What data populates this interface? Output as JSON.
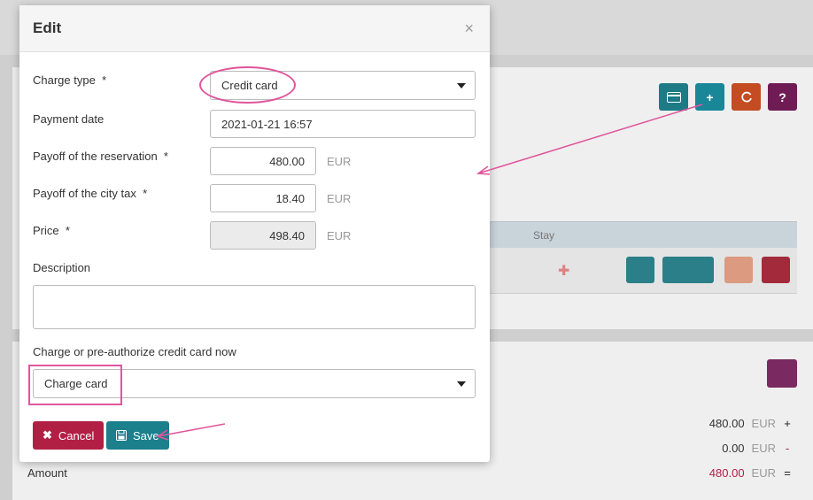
{
  "modal": {
    "title": "Edit",
    "close_symbol": "×",
    "charge_type": {
      "label": "Charge type",
      "required": "*",
      "value": "Credit card"
    },
    "payment_date": {
      "label": "Payment date",
      "value": "2021-01-21 16:57"
    },
    "payoff_reservation": {
      "label": "Payoff of the reservation",
      "required": "*",
      "value": "480.00",
      "unit": "EUR"
    },
    "payoff_city_tax": {
      "label": "Payoff of the city tax",
      "required": "*",
      "value": "18.40",
      "unit": "EUR"
    },
    "price": {
      "label": "Price",
      "required": "*",
      "value": "498.40",
      "unit": "EUR"
    },
    "description": {
      "label": "Description",
      "value": ""
    },
    "charge_now": {
      "label": "Charge or pre-authorize credit card now",
      "value": "Charge card"
    },
    "cancel_label": "Cancel",
    "save_label": "Save"
  },
  "background": {
    "table_header": "Stay",
    "help_symbol": "?",
    "add_symbol": "+",
    "totals": [
      {
        "value": "480.00",
        "unit": "EUR",
        "op": "+"
      },
      {
        "value": "0.00",
        "unit": "EUR",
        "op": "-"
      },
      {
        "value": "480.00",
        "unit": "EUR",
        "op": "="
      }
    ],
    "amount_label": "Amount"
  },
  "colors": {
    "cancel": "#b21f45",
    "save": "#1b7f8c",
    "annotation": "#e0559b",
    "total_negative": "#b21f45"
  }
}
